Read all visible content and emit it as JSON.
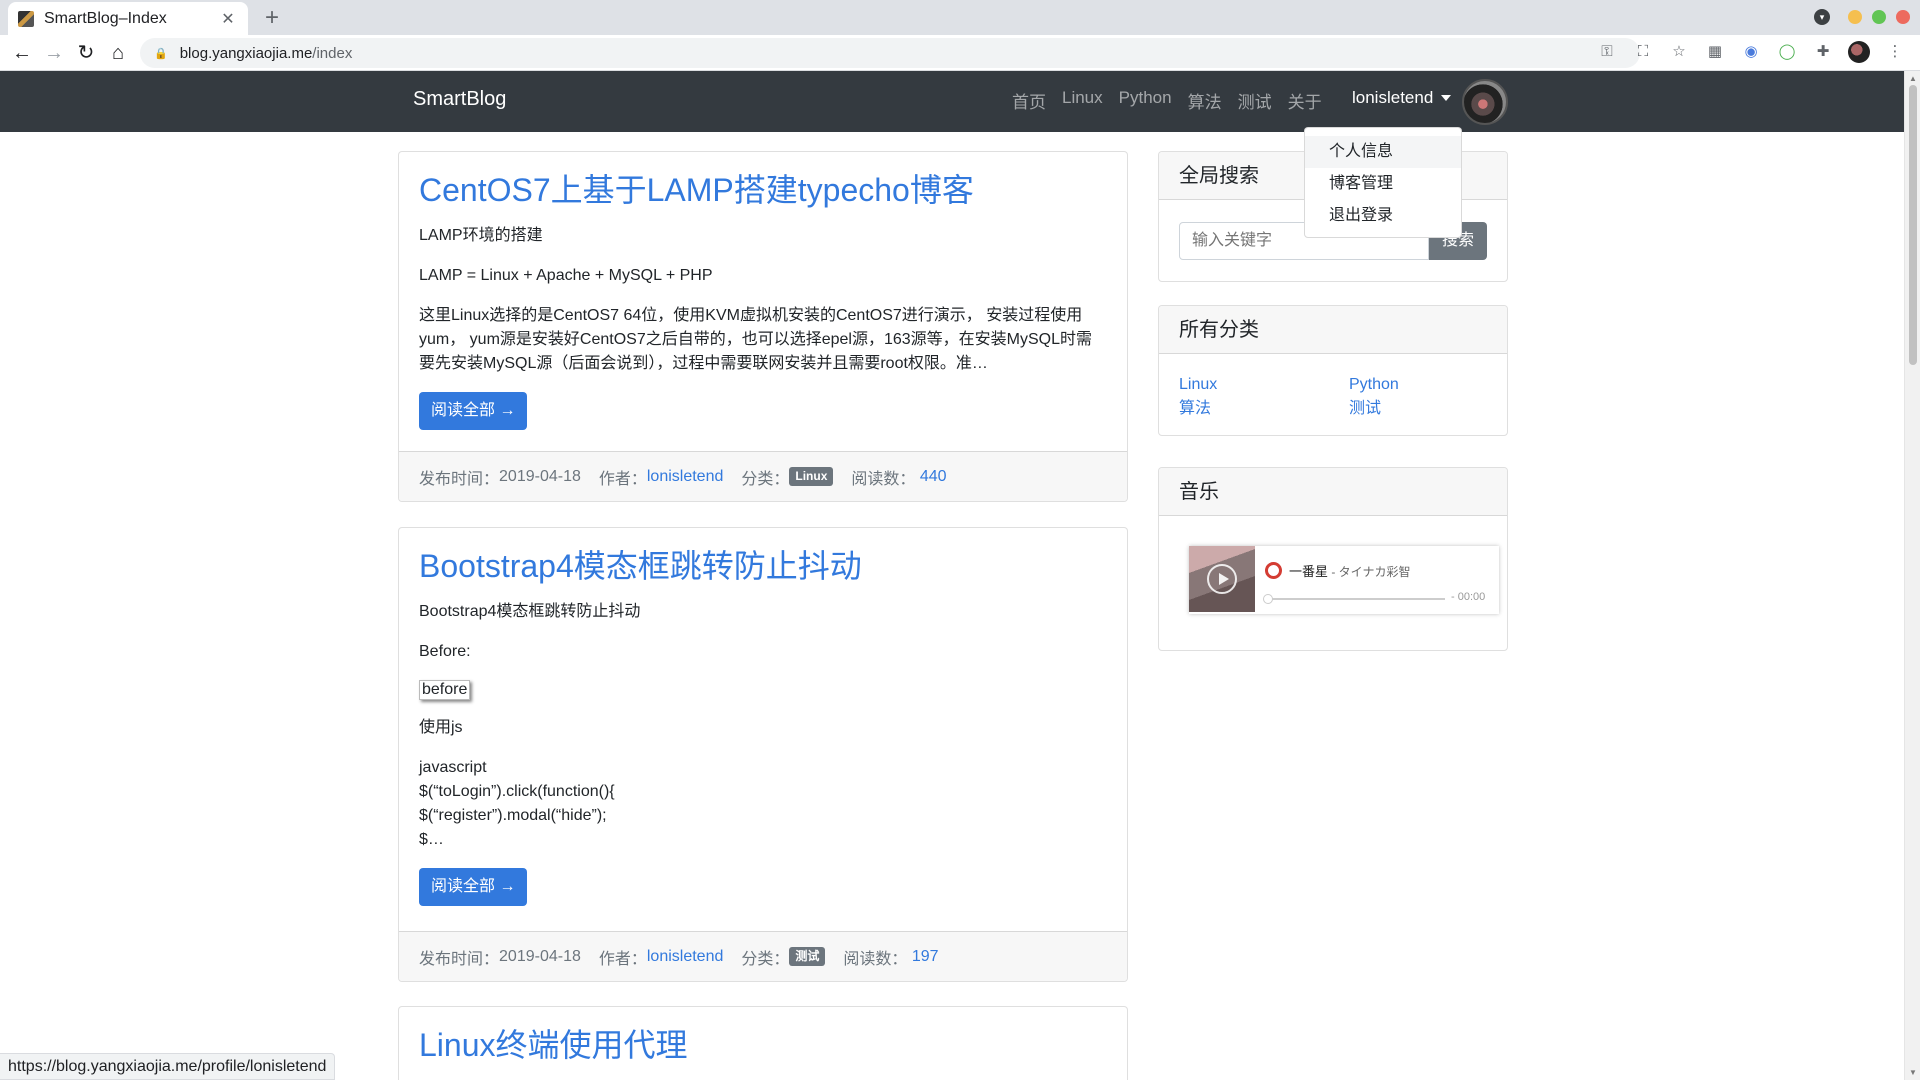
{
  "browser": {
    "tab_title": "SmartBlog–Index",
    "url_host": "blog.yangxiaojia.me",
    "url_path": "/index",
    "status_url": "https://blog.yangxiaojia.me/profile/lonisletend"
  },
  "navbar": {
    "brand": "SmartBlog",
    "links": [
      "首页",
      "Linux",
      "Python",
      "算法",
      "测试",
      "关于"
    ],
    "user": "lonisletend"
  },
  "dropdown": {
    "items": [
      "个人信息",
      "博客管理",
      "退出登录"
    ]
  },
  "posts": [
    {
      "title": "CentOS7上基于LAMP搭建typecho博客",
      "p1": "LAMP环境的搭建",
      "p2": "LAMP = Linux + Apache + MySQL + PHP",
      "p3": "这里Linux选择的是CentOS7 64位，使用KVM虚拟机安装的CentOS7进行演示， 安装过程使用yum， yum源是安装好CentOS7之后自带的，也可以选择epel源，163源等，在安装MySQL时需要先安装MySQL源（后面会说到），过程中需要联网安装并且需要root权限。准…",
      "read_more": "阅读全部 →",
      "meta": {
        "date_label": "发布时间：",
        "date": "2019-04-18",
        "author_label": "作者：",
        "author": "lonisletend",
        "cat_label": "分类：",
        "category": "Linux",
        "views_label": "阅读数：",
        "views": "440"
      }
    },
    {
      "title": "Bootstrap4模态框跳转防止抖动",
      "p1": "Bootstrap4模态框跳转防止抖动",
      "p2": "Before:",
      "img_alt": "before",
      "p3": "使用js",
      "code": [
        "javascript",
        "$(“toLogin”).click(function(){",
        "$(“register”).modal(“hide”);",
        "$…"
      ],
      "read_more": "阅读全部 →",
      "meta": {
        "date_label": "发布时间：",
        "date": "2019-04-18",
        "author_label": "作者：",
        "author": "lonisletend",
        "cat_label": "分类：",
        "category": "测试",
        "views_label": "阅读数：",
        "views": "197"
      }
    },
    {
      "title": "Linux终端使用代理"
    }
  ],
  "sidebar": {
    "search": {
      "title": "全局搜索",
      "placeholder": "输入关键字",
      "button": "搜索"
    },
    "categories": {
      "title": "所有分类",
      "items": [
        "Linux",
        "Python",
        "算法",
        "测试"
      ]
    },
    "music": {
      "title": "音乐",
      "song": "一番星",
      "artist": " - タイナカ彩智",
      "time": "- 00:00"
    }
  }
}
